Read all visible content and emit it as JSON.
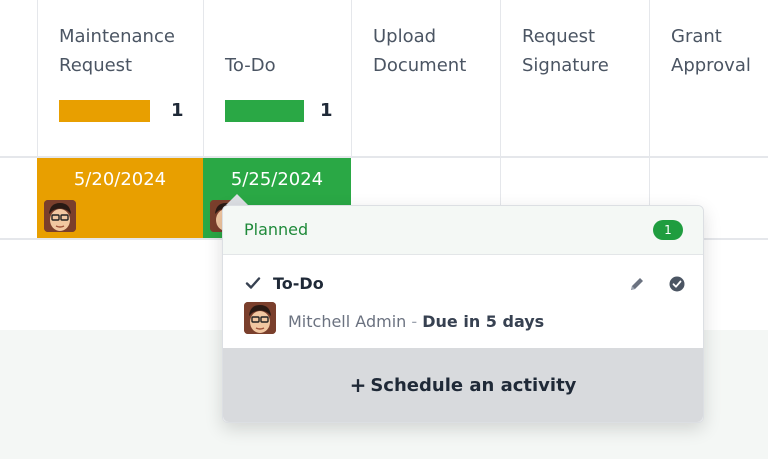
{
  "colors": {
    "maintenance": "#e89f00",
    "todo": "#2aa845",
    "planned_text": "#1f8a3a",
    "badge": "#1f9d3f"
  },
  "columns": [
    {
      "label": "Maintenance\nRequest",
      "count": "1",
      "bar_color": "#e89f00"
    },
    {
      "label": "To-Do",
      "count": "1",
      "bar_color": "#2aa845"
    },
    {
      "label": "Upload\nDocument"
    },
    {
      "label": "Request\nSignature"
    },
    {
      "label": "Grant\nApproval"
    }
  ],
  "row": {
    "maintenance_date": "5/20/2024",
    "todo_date": "5/25/2024"
  },
  "popover": {
    "title": "Planned",
    "badge": "1",
    "activity": {
      "icon": "check-icon",
      "title": "To-Do",
      "user": "Mitchell Admin",
      "separator": "-",
      "due": "Due in 5 days"
    },
    "schedule_label": "Schedule an activity"
  }
}
